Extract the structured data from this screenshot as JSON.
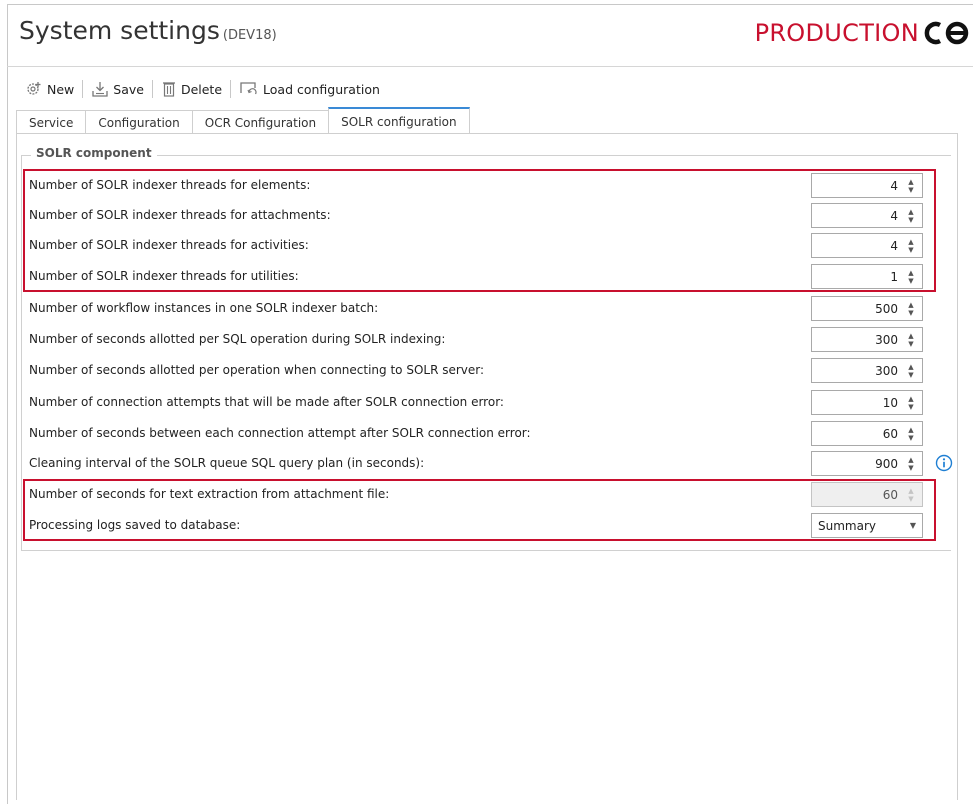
{
  "header": {
    "title": "System settings",
    "environment": "(DEV18)",
    "brand": "PRODUCTION"
  },
  "toolbar": {
    "new_label": "New",
    "save_label": "Save",
    "delete_label": "Delete",
    "load_label": "Load configuration"
  },
  "tabs": [
    {
      "label": "Service",
      "active": false
    },
    {
      "label": "Configuration",
      "active": false
    },
    {
      "label": "OCR Configuration",
      "active": false
    },
    {
      "label": "SOLR configuration",
      "active": true
    }
  ],
  "group": {
    "title": "SOLR component"
  },
  "settings": [
    {
      "label": "Number of SOLR indexer threads for elements:",
      "value": "4"
    },
    {
      "label": "Number of SOLR indexer threads for attachments:",
      "value": "4"
    },
    {
      "label": "Number of SOLR indexer threads for activities:",
      "value": "4"
    },
    {
      "label": "Number of SOLR indexer threads for utilities:",
      "value": "1"
    },
    {
      "label": "Number of workflow instances in one SOLR indexer batch:",
      "value": "500"
    },
    {
      "label": "Number of seconds allotted per SQL operation during SOLR indexing:",
      "value": "300"
    },
    {
      "label": "Number of seconds allotted per operation when connecting to SOLR server:",
      "value": "300"
    },
    {
      "label": "Number of connection attempts that will be made after SOLR connection error:",
      "value": "10"
    },
    {
      "label": "Number of seconds between each connection attempt after SOLR connection error:",
      "value": "60"
    },
    {
      "label": "Cleaning interval of the SOLR queue SQL query plan (in seconds):",
      "value": "900"
    },
    {
      "label": "Number of seconds for text extraction from attachment file:",
      "value": "60",
      "disabled": true
    },
    {
      "label": "Processing logs saved to database:",
      "value": "Summary",
      "type": "dropdown"
    }
  ],
  "colors": {
    "brand": "#c8102e",
    "highlight": "#c8102e",
    "active_tab": "#3a8ad6",
    "info": "#1f7fd3"
  },
  "icons": {
    "new": "gear-plus-icon",
    "save": "save-icon",
    "delete": "trash-icon",
    "load": "load-configuration-icon",
    "info": "info-icon"
  }
}
